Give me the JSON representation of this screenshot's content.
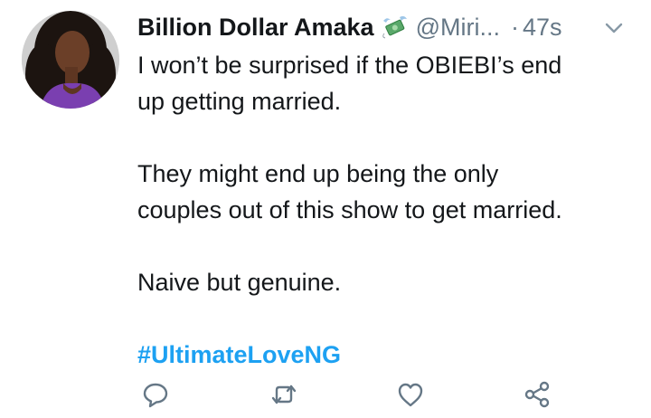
{
  "tweet": {
    "display_name": "Billion Dollar Amaka",
    "badge_icon": "money-with-wings-emoji",
    "handle": "@Miri...",
    "separator": "·",
    "timestamp": "47s",
    "body": {
      "line1": "I won’t be surprised if the OBIEBI’s end",
      "line2": "up getting married.",
      "line3": "They might end up being the only",
      "line4": "couples out of this show to get married.",
      "line5": "Naive but genuine.",
      "hashtag": "#UltimateLoveNG"
    },
    "actions": [
      {
        "icon": "reply-icon"
      },
      {
        "icon": "retweet-icon"
      },
      {
        "icon": "like-icon"
      },
      {
        "icon": "share-icon"
      }
    ]
  },
  "colors": {
    "text": "#14171a",
    "secondary": "#657786",
    "link": "#1da1f2"
  }
}
